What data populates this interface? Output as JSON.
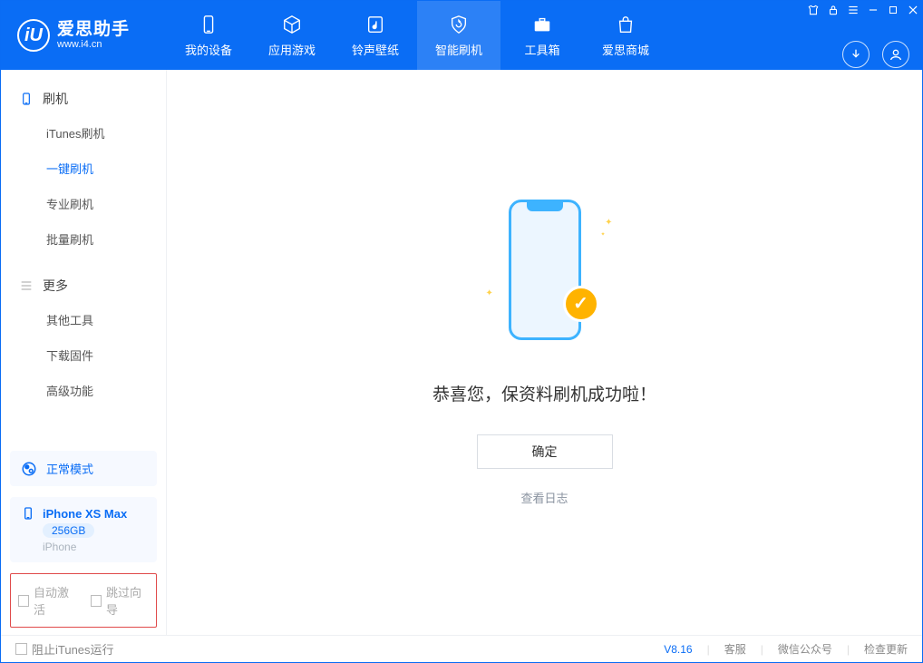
{
  "brand": {
    "title": "爱思助手",
    "subtitle": "www.i4.cn"
  },
  "nav": {
    "items": [
      {
        "label": "我的设备"
      },
      {
        "label": "应用游戏"
      },
      {
        "label": "铃声壁纸"
      },
      {
        "label": "智能刷机"
      },
      {
        "label": "工具箱"
      },
      {
        "label": "爱思商城"
      }
    ]
  },
  "sidebar": {
    "section1_title": "刷机",
    "items1": [
      {
        "label": "iTunes刷机"
      },
      {
        "label": "一键刷机"
      },
      {
        "label": "专业刷机"
      },
      {
        "label": "批量刷机"
      }
    ],
    "section2_title": "更多",
    "items2": [
      {
        "label": "其他工具"
      },
      {
        "label": "下载固件"
      },
      {
        "label": "高级功能"
      }
    ],
    "mode": "正常模式",
    "device": {
      "name": "iPhone XS Max",
      "storage": "256GB",
      "type": "iPhone"
    },
    "chk_auto_activate": "自动激活",
    "chk_skip_guide": "跳过向导"
  },
  "main": {
    "success_text": "恭喜您，保资料刷机成功啦！",
    "ok_label": "确定",
    "log_link": "查看日志"
  },
  "footer": {
    "block_itunes": "阻止iTunes运行",
    "version": "V8.16",
    "links": [
      {
        "label": "客服"
      },
      {
        "label": "微信公众号"
      },
      {
        "label": "检查更新"
      }
    ]
  }
}
